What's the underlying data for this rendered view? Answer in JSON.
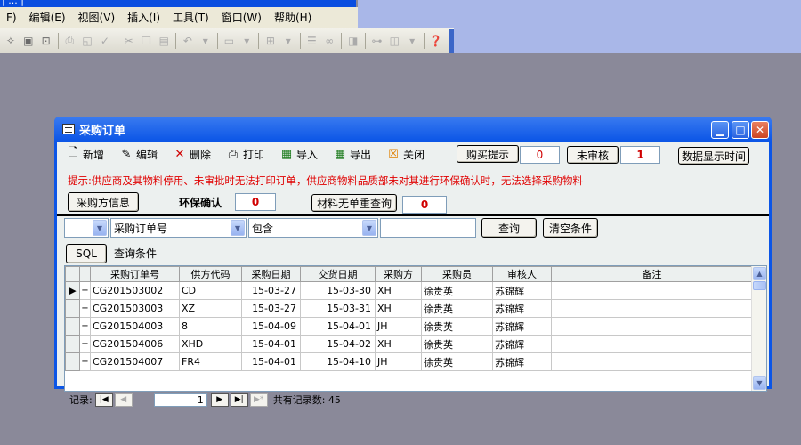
{
  "app": {
    "title_fragment": "| ... |"
  },
  "menu": {
    "items": [
      {
        "label": "F)"
      },
      {
        "label": "编辑(E)"
      },
      {
        "label": "视图(V)"
      },
      {
        "label": "插入(I)"
      },
      {
        "label": "工具(T)"
      },
      {
        "label": "窗口(W)"
      },
      {
        "label": "帮助(H)"
      }
    ]
  },
  "window": {
    "title": "采购订单"
  },
  "actions": {
    "new": "新增",
    "edit": "编辑",
    "delete": "删除",
    "print": "打印",
    "import": "导入",
    "export": "导出",
    "close": "关闭",
    "purchase_prompt": "购买提示",
    "purchase_prompt_count": "0",
    "unreviewed": "未审核",
    "unreviewed_count": "1",
    "data_display_time": "数据显示时间"
  },
  "hint": "提示:供应商及其物料停用、未审批时无法打印订单，供应商物料品质部未对其进行环保确认时，无法选择采购物料",
  "info_row": {
    "buyer_info": "采购方信息",
    "env_confirm_label": "环保确认",
    "env_confirm_count": "0",
    "material_query": "材料无单重查询",
    "material_count": "0"
  },
  "query": {
    "logic_value": "",
    "field_value": "采购订单号",
    "operator_value": "包含",
    "input_value": "",
    "query_button": "查询",
    "clear_button": "清空条件",
    "sql_button": "SQL",
    "conditions_label": "查询条件"
  },
  "grid": {
    "columns": [
      "采购订单号",
      "供方代码",
      "采购日期",
      "交货日期",
      "采购方",
      "采购员",
      "审核人",
      "备注"
    ],
    "rows": [
      {
        "order_no": "CG201503002",
        "supplier": "CD",
        "purchase_date": "15-03-27",
        "delivery_date": "15-03-30",
        "buyer": "XH",
        "clerk": "徐贵英",
        "reviewer": "苏锦辉",
        "note": ""
      },
      {
        "order_no": "CG201503003",
        "supplier": "XZ",
        "purchase_date": "15-03-27",
        "delivery_date": "15-03-31",
        "buyer": "XH",
        "clerk": "徐贵英",
        "reviewer": "苏锦辉",
        "note": ""
      },
      {
        "order_no": "CG201504003",
        "supplier": "8",
        "purchase_date": "15-04-09",
        "delivery_date": "15-04-01",
        "buyer": "JH",
        "clerk": "徐贵英",
        "reviewer": "苏锦辉",
        "note": ""
      },
      {
        "order_no": "CG201504006",
        "supplier": "XHD",
        "purchase_date": "15-04-01",
        "delivery_date": "15-04-02",
        "buyer": "XH",
        "clerk": "徐贵英",
        "reviewer": "苏锦辉",
        "note": ""
      },
      {
        "order_no": "CG201504007",
        "supplier": "FR4",
        "purchase_date": "15-04-01",
        "delivery_date": "15-04-10",
        "buyer": "JH",
        "clerk": "徐贵英",
        "reviewer": "苏锦辉",
        "note": ""
      }
    ]
  },
  "navigator": {
    "label": "记录:",
    "current": "1",
    "total_text": "共有记录数: 45"
  }
}
